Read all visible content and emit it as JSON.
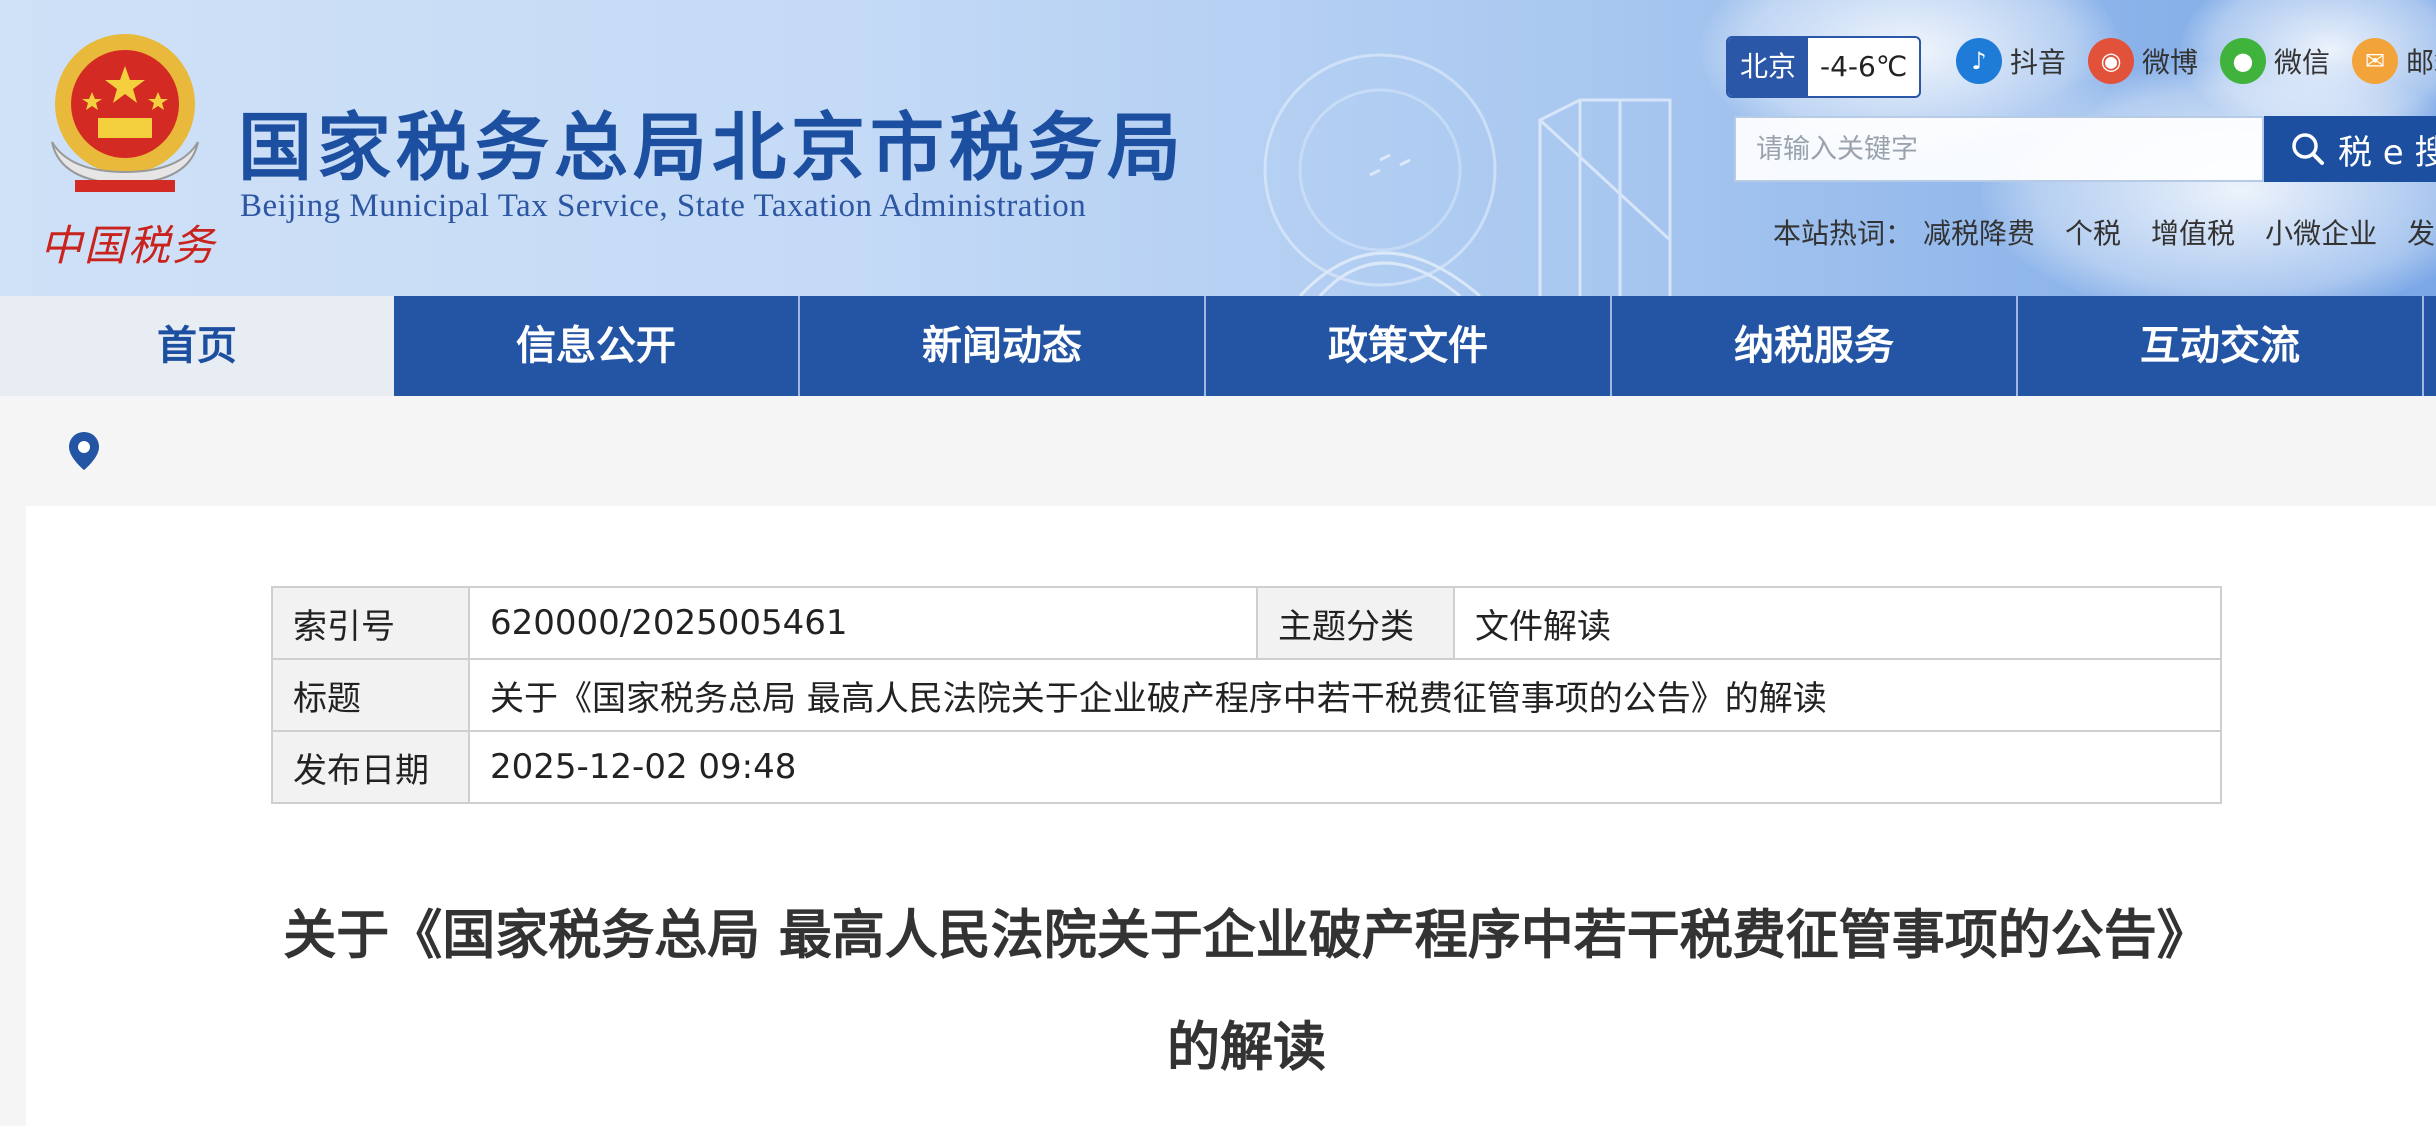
{
  "header": {
    "site_title": "国家税务总局北京市税务局",
    "site_subtitle": "Beijing Municipal Tax Service, State Taxation Administration",
    "emblem_text": "中国税务",
    "weather": {
      "city": "北京",
      "temperature": "-4-6℃"
    },
    "socials": [
      {
        "label": "抖音",
        "icon": "douyin-icon",
        "color": "#1e7bd8"
      },
      {
        "label": "微博",
        "icon": "weibo-icon",
        "color": "#e2513a"
      },
      {
        "label": "微信",
        "icon": "wechat-icon",
        "color": "#3fb33b"
      },
      {
        "label": "邮箱",
        "icon": "mail-icon",
        "color": "#f2a43a"
      }
    ],
    "search": {
      "placeholder": "请输入关键字",
      "button_label": "税 e 搜"
    },
    "hot_words": {
      "label": "本站热词：",
      "items": [
        "减税降费",
        "个税",
        "增值税",
        "小微企业",
        "发票"
      ]
    }
  },
  "nav": {
    "items": [
      {
        "label": "首页",
        "active": true
      },
      {
        "label": "信息公开"
      },
      {
        "label": "新闻动态"
      },
      {
        "label": "政策文件"
      },
      {
        "label": "纳税服务"
      },
      {
        "label": "互动交流"
      }
    ]
  },
  "breadcrumb": {
    "icon": "location-pin-icon"
  },
  "meta": {
    "index_label": "索引号",
    "index_value": "620000/2025005461",
    "topic_label": "主题分类",
    "topic_value": "文件解读",
    "title_label": "标题",
    "title_value": "关于《国家税务总局 最高人民法院关于企业破产程序中若干税费征管事项的公告》的解读",
    "date_label": "发布日期",
    "date_value": "2025-12-02 09:48"
  },
  "article": {
    "title": "关于《国家税务总局 最高人民法院关于企业破产程序中若干税费征管事项的公告》的解读"
  },
  "colors": {
    "brand_blue": "#2455a5",
    "title_blue": "#1d4fa0",
    "emblem_red": "#d42a24"
  }
}
